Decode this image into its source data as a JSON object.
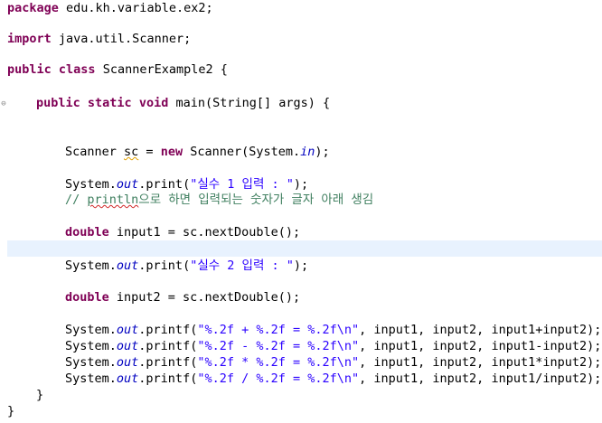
{
  "lines": {
    "pkg": {
      "kw": "package",
      "rest": " edu.kh.variable.ex2;"
    },
    "imp": {
      "kw": "import",
      "rest": " java.util.Scanner;"
    },
    "cls": {
      "kw1": "public",
      "kw2": "class",
      "rest": " ScannerExample2 {"
    },
    "main": {
      "kw1": "public",
      "kw2": "static",
      "kw3": "void",
      "rest": " main(String[] args) {"
    },
    "scanner": {
      "a": "Scanner ",
      "var": "sc",
      "b": " = ",
      "kw": "new",
      "c": " Scanner(System.",
      "fld": "in",
      "d": ");"
    },
    "p1": {
      "a": "System.",
      "fld": "out",
      "b": ".print(",
      "str": "\"실수 1 입력 : \"",
      "c": ");"
    },
    "comment": {
      "a": "// ",
      "typo": "println",
      "b": "으로 하면 입력되는 숫자가 글자 아래 생김"
    },
    "in1": {
      "kw": "double",
      "rest": " input1 = sc.nextDouble();"
    },
    "p2": {
      "a": "System.",
      "fld": "out",
      "b": ".print(",
      "str": "\"실수 2 입력 : \"",
      "c": ");"
    },
    "in2": {
      "kw": "double",
      "rest": " input2 = sc.nextDouble();"
    },
    "pf1": {
      "a": "System.",
      "fld": "out",
      "b": ".printf(",
      "str": "\"%.2f + %.2f = %.2f\\n\"",
      "c": ", input1, input2, input1+input2);"
    },
    "pf2": {
      "a": "System.",
      "fld": "out",
      "b": ".printf(",
      "str": "\"%.2f - %.2f = %.2f\\n\"",
      "c": ", input1, input2, input1-input2);"
    },
    "pf3": {
      "a": "System.",
      "fld": "out",
      "b": ".printf(",
      "str": "\"%.2f * %.2f = %.2f\\n\"",
      "c": ", input1, input2, input1*input2);"
    },
    "pf4": {
      "a": "System.",
      "fld": "out",
      "b": ".printf(",
      "str": "\"%.2f / %.2f = %.2f\\n\"",
      "c": ", input1, input2, input1/input2);"
    },
    "close_method": "}",
    "close_class": "}"
  },
  "fold_marker": "⊖",
  "colors": {
    "keyword": "#7f0055",
    "string": "#2a00ff",
    "field": "#0000c0",
    "comment": "#3f7f5f",
    "current_line": "#e8f2fe"
  }
}
